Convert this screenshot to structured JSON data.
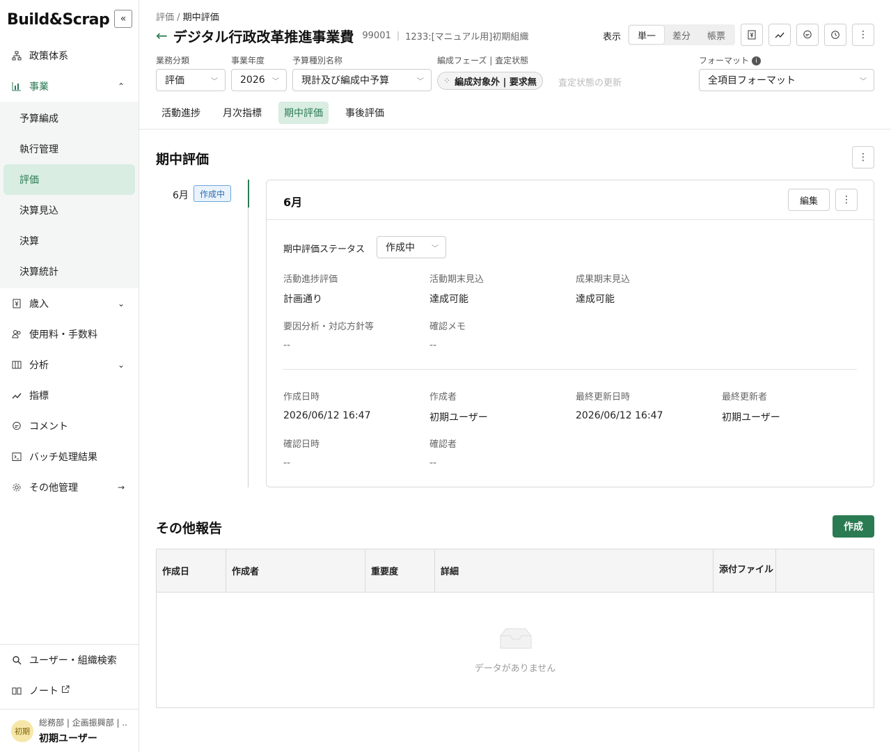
{
  "brand": {
    "name": "Build&Scrap"
  },
  "sidebar": {
    "items": [
      {
        "label": "政策体系",
        "icon": "hierarchy-icon"
      },
      {
        "label": "事業",
        "icon": "bar-chart-icon"
      },
      {
        "label": "歳入",
        "icon": "yen-icon"
      },
      {
        "label": "使用料・手数料",
        "icon": "people-icon"
      },
      {
        "label": "分析",
        "icon": "board-icon"
      },
      {
        "label": "指標",
        "icon": "trend-icon"
      },
      {
        "label": "コメント",
        "icon": "comment-icon"
      },
      {
        "label": "バッチ処理結果",
        "icon": "terminal-icon"
      },
      {
        "label": "その他管理",
        "icon": "gear-icon"
      }
    ],
    "subitems": [
      "予算編成",
      "執行管理",
      "評価",
      "決算見込",
      "決算",
      "決算統計"
    ],
    "bottom": [
      {
        "label": "ユーザー・組織検索",
        "icon": "search-icon"
      },
      {
        "label": "ノート",
        "icon": "book-icon"
      }
    ],
    "user": {
      "avatar": "初期",
      "org": "総務部 | 企画振興部 | ...",
      "name": "初期ユーザー"
    }
  },
  "header": {
    "breadcrumb": [
      "評価",
      "期中評価"
    ],
    "title": "デジタル行政改革推進事業費",
    "code": "99001",
    "org": "1233:[マニュアル用]初期組織",
    "display_label": "表示",
    "display_options": [
      "単一",
      "差分",
      "帳票"
    ],
    "display_selected": "単一"
  },
  "filters": {
    "business_category": {
      "label": "業務分類",
      "value": "評価"
    },
    "fiscal_year": {
      "label": "事業年度",
      "value": "2026"
    },
    "budget_type": {
      "label": "予算種別名称",
      "value": "現計及び編成中予算"
    },
    "phase": {
      "label": "編成フェーズ | 査定状態",
      "value": "編成対象外 | 要求無"
    },
    "update_link": "査定状態の更新",
    "format": {
      "label": "フォーマット",
      "value": "全項目フォーマット"
    }
  },
  "tabs": [
    "活動進捗",
    "月次指標",
    "期中評価",
    "事後評価"
  ],
  "active_tab": "期中評価",
  "midterm": {
    "section_title": "期中評価",
    "month": "6月",
    "month_status": "作成中",
    "card_title": "6月",
    "edit_label": "編集",
    "status_label": "期中評価ステータス",
    "status_value": "作成中",
    "fields": {
      "activity_progress": {
        "label": "活動進捗評価",
        "value": "計画通り"
      },
      "activity_outlook": {
        "label": "活動期末見込",
        "value": "達成可能"
      },
      "outcome_outlook": {
        "label": "成果期末見込",
        "value": "達成可能"
      },
      "factor_analysis": {
        "label": "要因分析・対応方針等",
        "value": "--"
      },
      "check_memo": {
        "label": "確認メモ",
        "value": "--"
      },
      "created_at": {
        "label": "作成日時",
        "value": "2026/06/12 16:47"
      },
      "created_by": {
        "label": "作成者",
        "value": "初期ユーザー"
      },
      "updated_at": {
        "label": "最終更新日時",
        "value": "2026/06/12 16:47"
      },
      "updated_by": {
        "label": "最終更新者",
        "value": "初期ユーザー"
      },
      "confirmed_at": {
        "label": "確認日時",
        "value": "--"
      },
      "confirmed_by": {
        "label": "確認者",
        "value": "--"
      }
    }
  },
  "other_reports": {
    "title": "その他報告",
    "create_label": "作成",
    "columns": [
      "作成日",
      "作成者",
      "重要度",
      "詳細",
      "添付ファイル"
    ],
    "empty_text": "データがありません"
  },
  "colors": {
    "accent": "#2a7a52",
    "accent_light": "#d9ede2",
    "tag_blue": "#2b6cb0"
  }
}
